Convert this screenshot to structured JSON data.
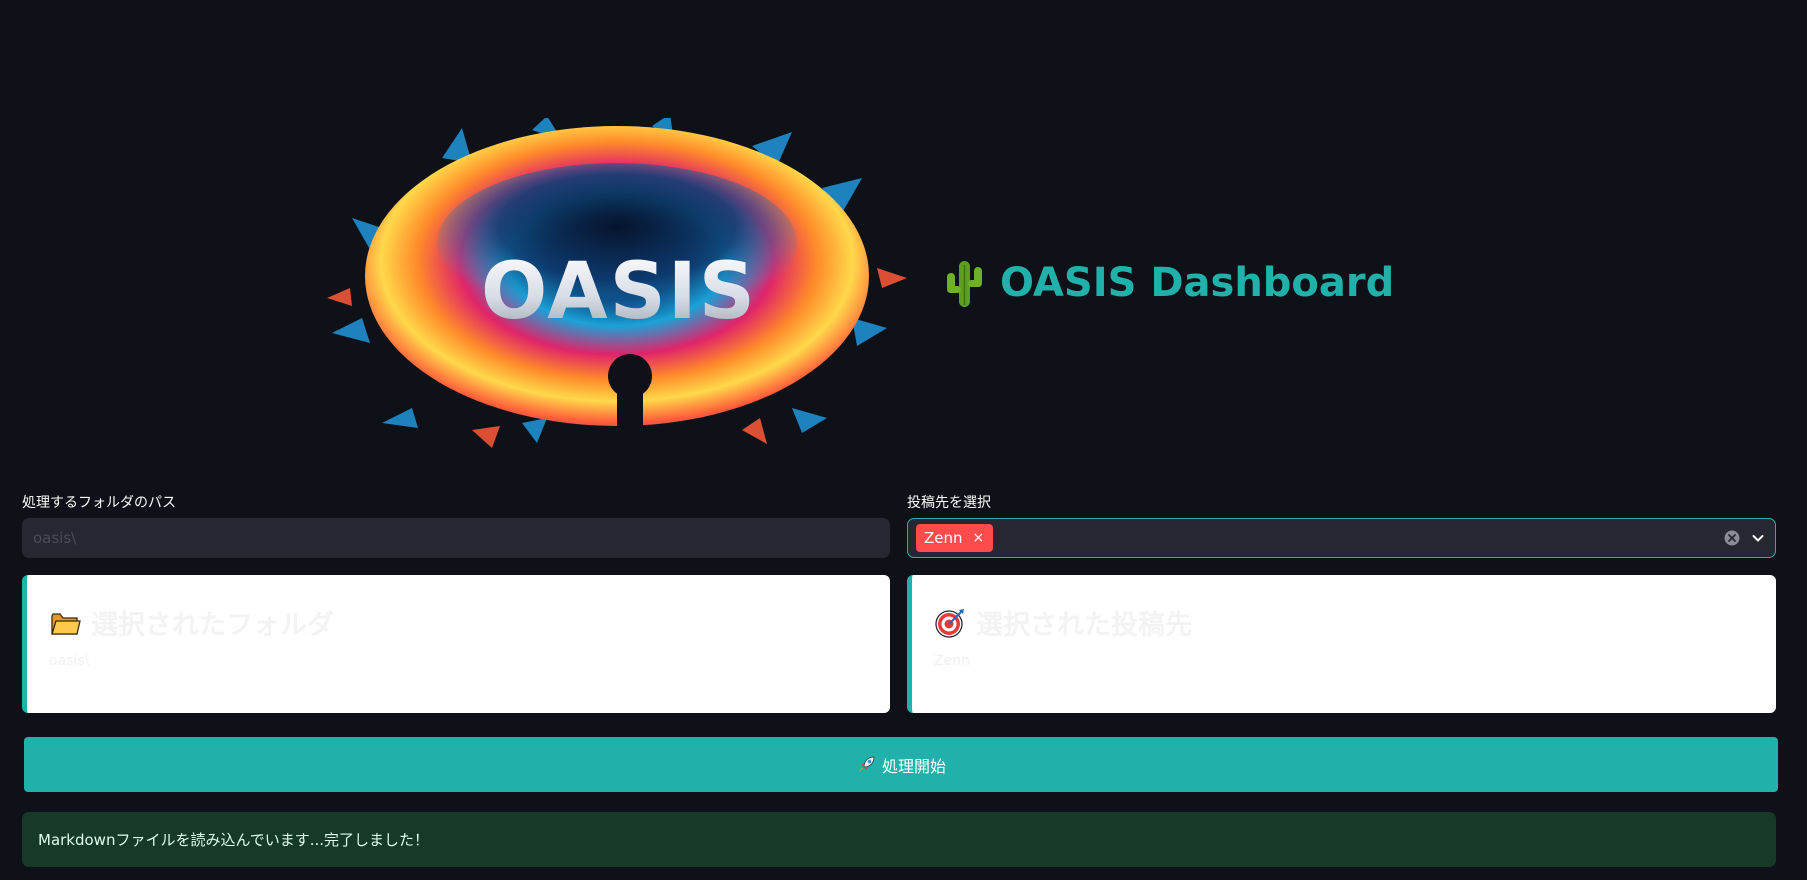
{
  "hero": {
    "logo_text": "OASIS",
    "title": "OASIS Dashboard",
    "title_icon": "cactus-icon"
  },
  "form": {
    "folder_label": "処理するフォルダのパス",
    "folder_value": "oasis\\",
    "target_label": "投稿先を選択",
    "selected_tags": [
      "Zenn"
    ],
    "tag_remove_glyph": "×"
  },
  "cards": {
    "folder": {
      "icon": "folder-icon",
      "title": "選択されたフォルダ",
      "value": "oasis\\"
    },
    "target": {
      "icon": "target-icon",
      "title": "選択された投稿先",
      "value": "Zenn"
    }
  },
  "action": {
    "icon": "rocket-icon",
    "label": "処理開始"
  },
  "status": {
    "message": "Markdownファイルを読み込んでいます...完了しました！"
  },
  "colors": {
    "background": "#0e1117",
    "accent": "#20b2aa",
    "tag": "#ff4b4b",
    "input_bg": "#262730",
    "success_bg": "#173928"
  }
}
